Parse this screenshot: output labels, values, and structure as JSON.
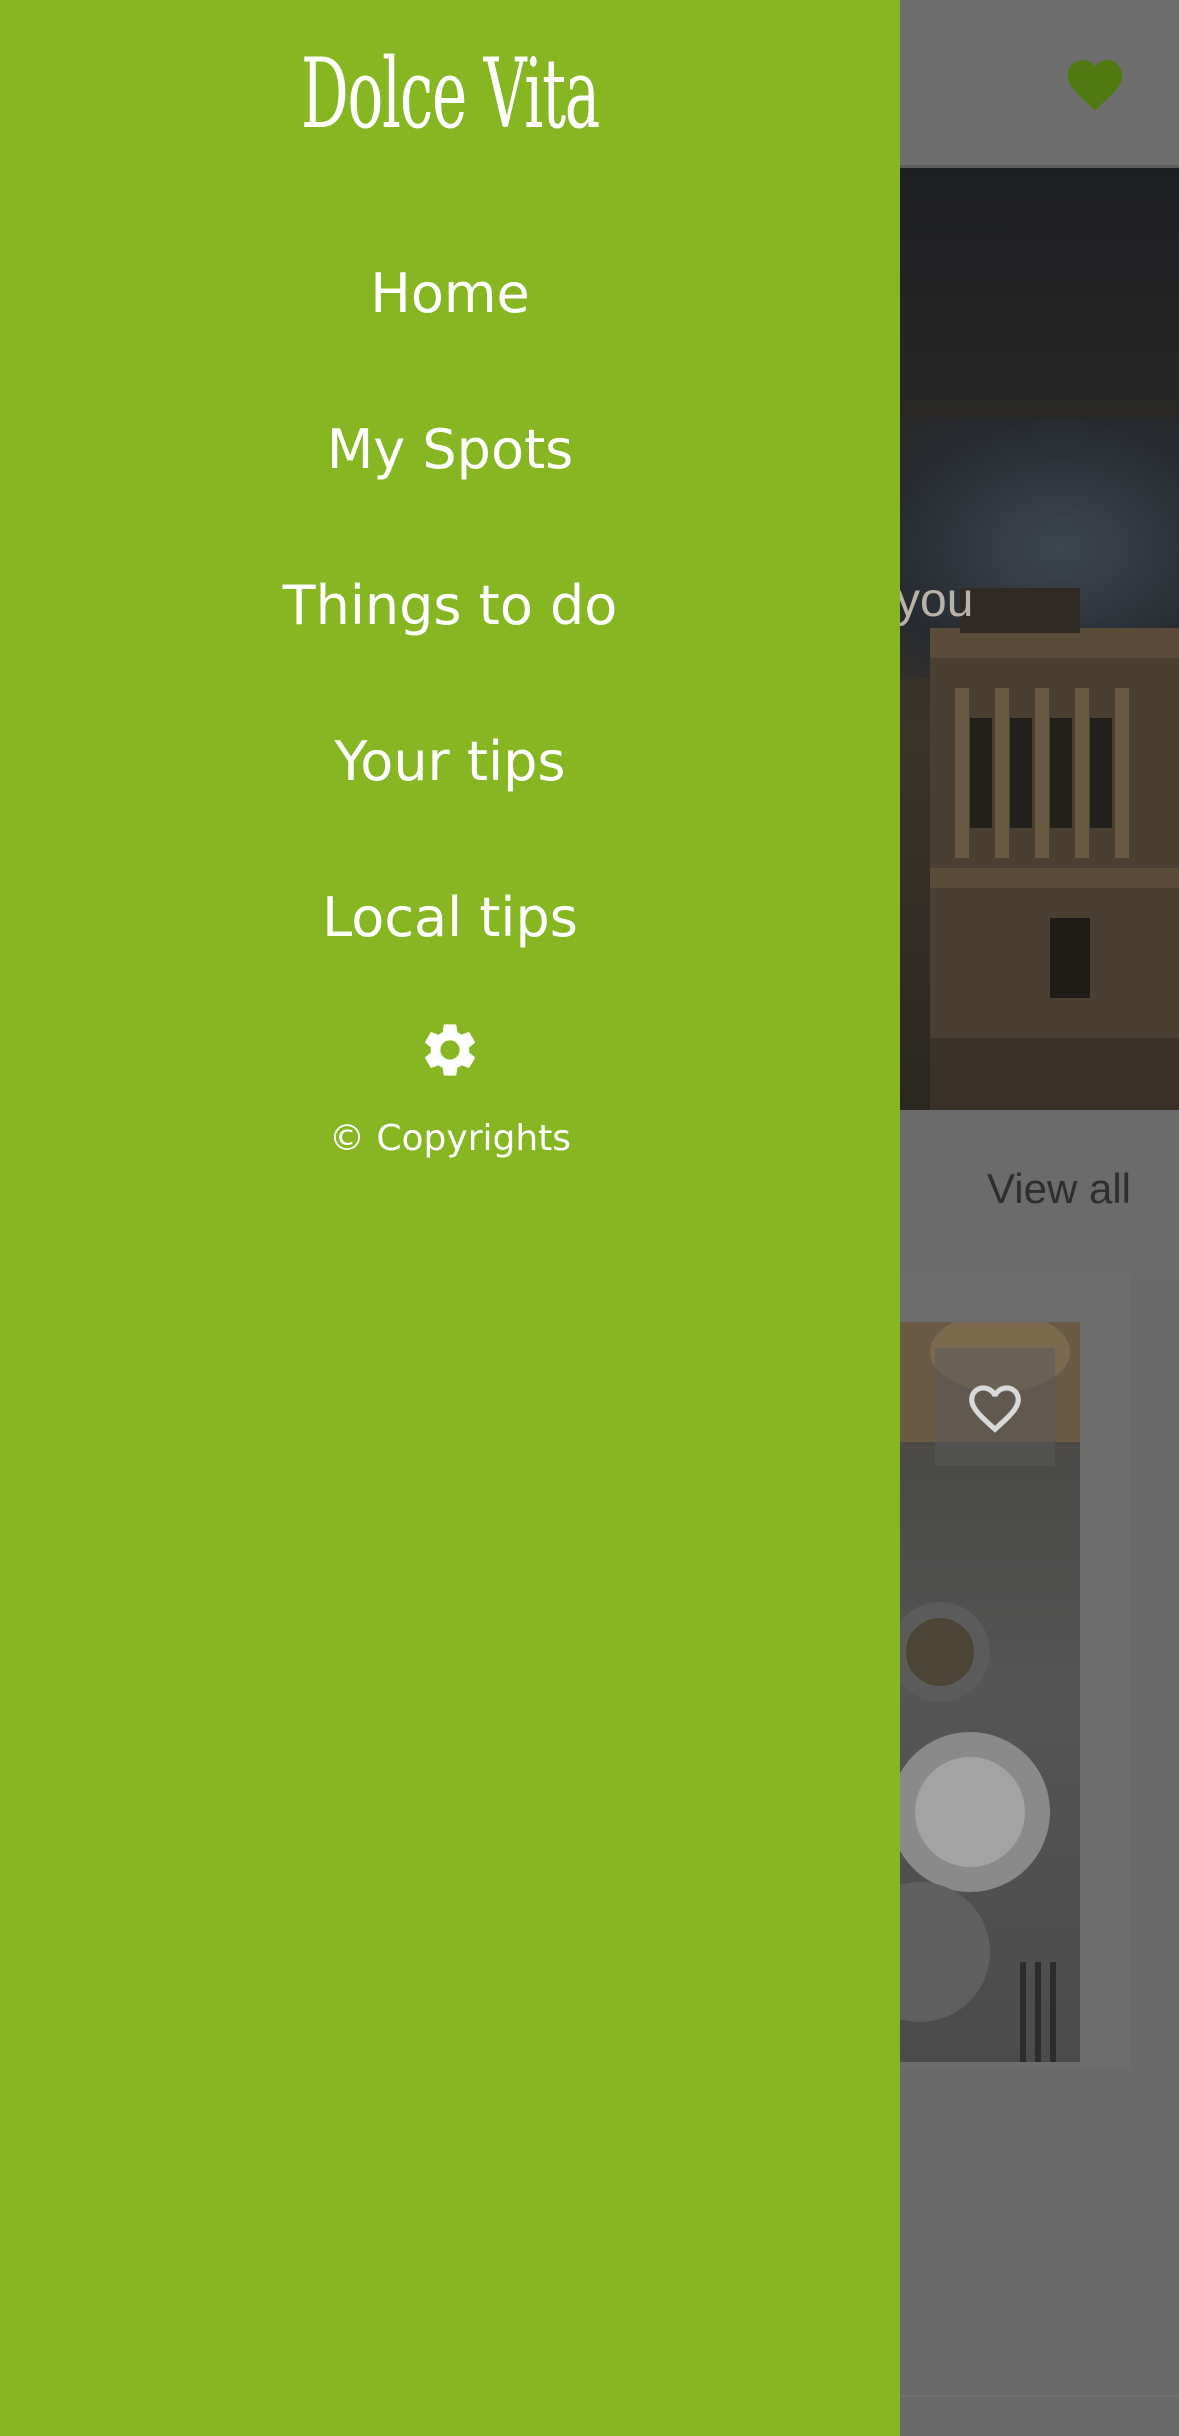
{
  "colors": {
    "drawer_background": "#87b623",
    "scrim": "#6a6a6a",
    "header_heart": "#4f7a12",
    "drawer_text": "#ffffff"
  },
  "drawer": {
    "brand": "Dolce Vita",
    "menu": [
      {
        "label": "Home"
      },
      {
        "label": "My Spots"
      },
      {
        "label": "Things to do"
      },
      {
        "label": "Your tips"
      },
      {
        "label": "Local tips"
      }
    ],
    "settings_icon": "gear-icon",
    "copyright": "© Copyrights"
  },
  "background": {
    "header_icon": "heart-filled-icon",
    "hero_text_fragment": "you",
    "section_link": "View all",
    "card_icon": "heart-outline-icon"
  }
}
